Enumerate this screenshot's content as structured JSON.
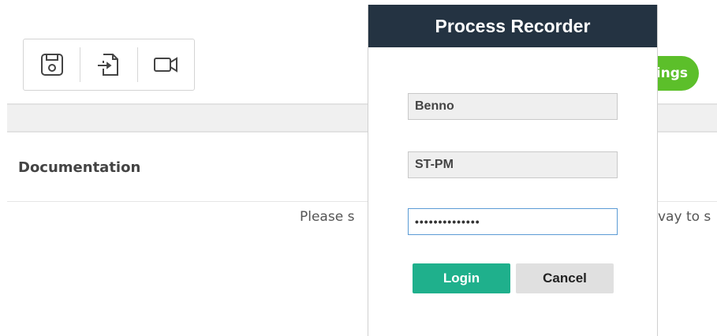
{
  "toolbar": {
    "buttons": [
      {
        "icon": "save-icon"
      },
      {
        "icon": "import-icon"
      },
      {
        "icon": "video-camera-icon"
      }
    ]
  },
  "background": {
    "pill_label": "ings",
    "section_title": "Documentation",
    "notice_left": "Please s",
    "notice_right": "vay to s"
  },
  "dialog": {
    "title": "Process Recorder",
    "username_value": "Benno",
    "workspace_value": "ST-PM",
    "password_value": "••••••••••••••",
    "login_label": "Login",
    "cancel_label": "Cancel"
  },
  "colors": {
    "header_bg": "#243342",
    "login_bg": "#1fb08c",
    "cancel_bg": "#e0e0e0",
    "pill_bg": "#5cbf2a"
  }
}
